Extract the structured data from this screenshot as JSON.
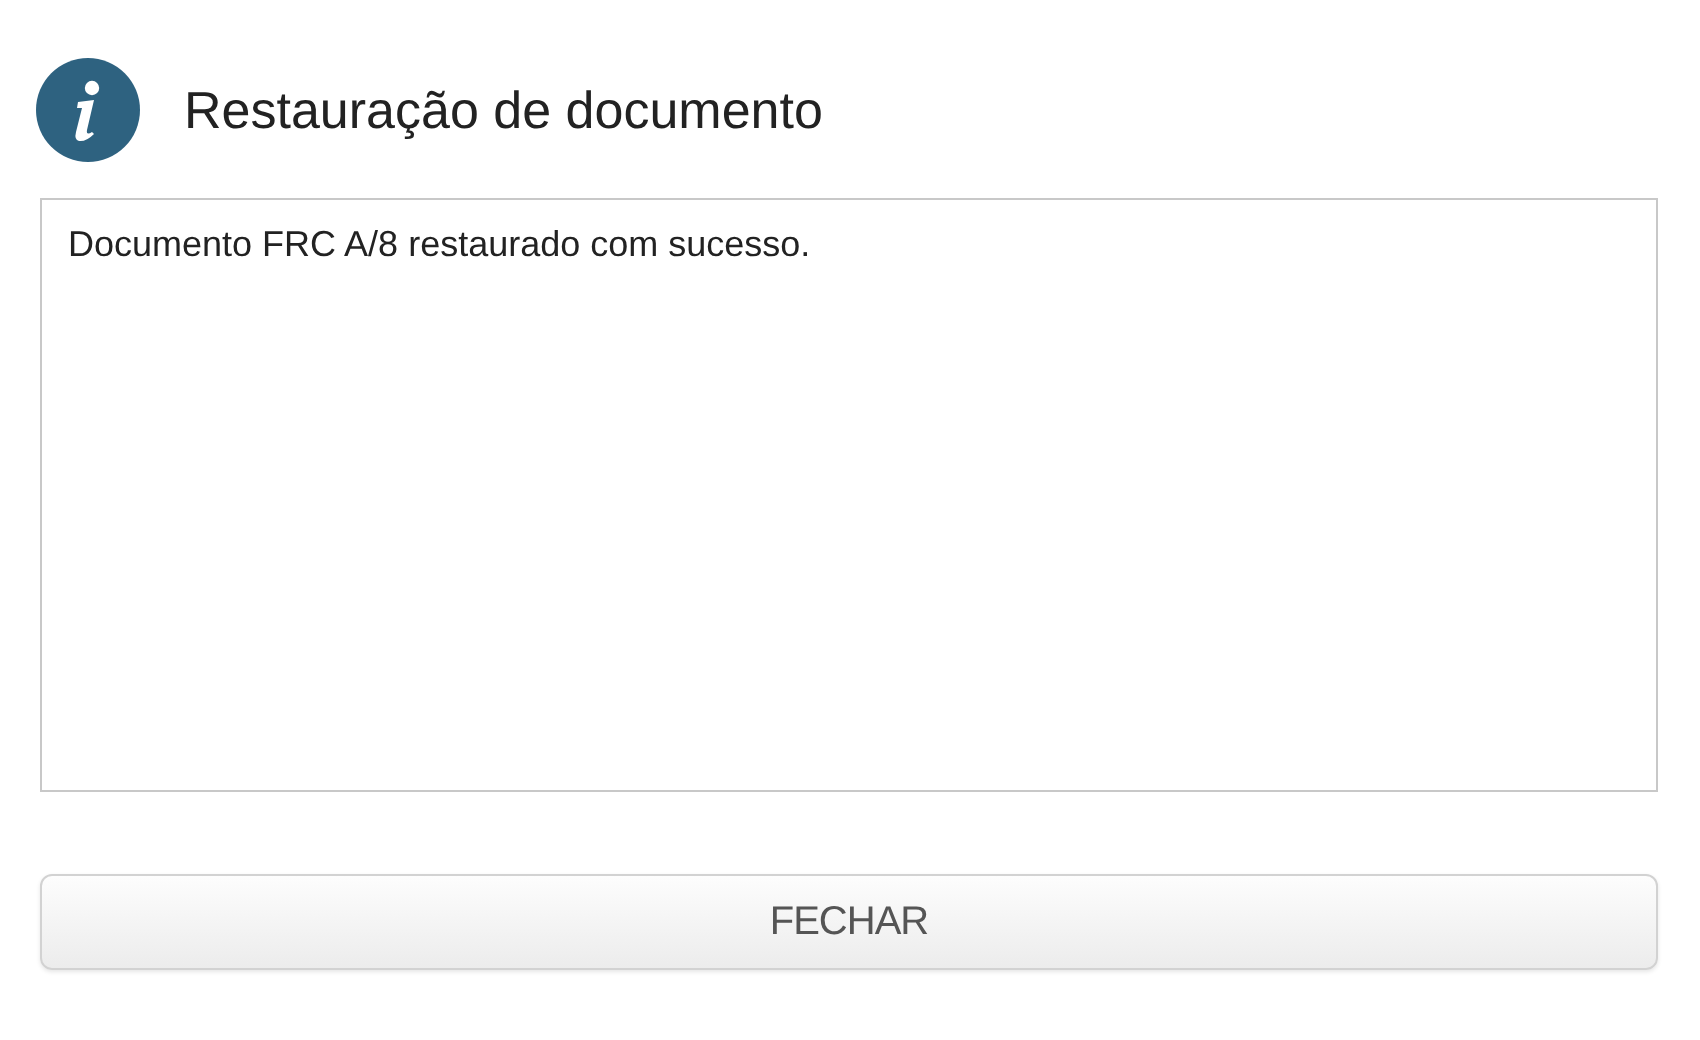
{
  "dialog": {
    "title": "Restauração de documento",
    "message": "Documento FRC A/8 restaurado com sucesso.",
    "buttons": [
      "FECHAR"
    ]
  }
}
